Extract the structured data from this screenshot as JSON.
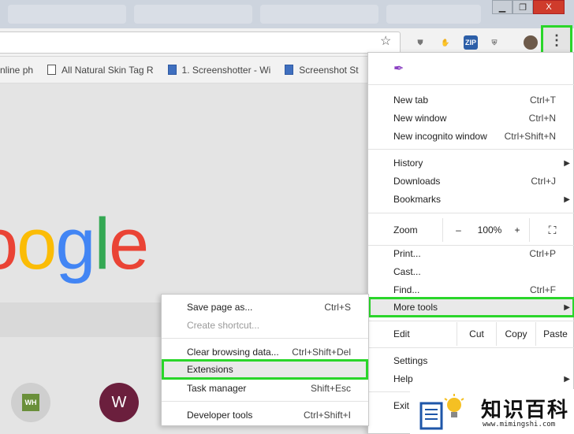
{
  "window": {
    "minimize": "▁",
    "restore": "❐",
    "close": "X"
  },
  "bookmarks": [
    {
      "label": "nline ph",
      "icon": "page-icon"
    },
    {
      "label": "All Natural Skin Tag R",
      "icon": "page-icon"
    },
    {
      "label": "1. Screenshotter - Wi",
      "icon": "doc-icon"
    },
    {
      "label": "Screenshot St",
      "icon": "doc-icon"
    }
  ],
  "extensions": {
    "zip_label": "ZIP"
  },
  "page": {
    "logo": [
      "o",
      "o",
      "g",
      "l",
      "e"
    ],
    "tile_label": "W",
    "tile_wh": "WH"
  },
  "colors": {
    "blue": "#4285f4",
    "red": "#ea4335",
    "yellow": "#fbbc05",
    "green": "#34a853",
    "highlight": "#2ad62a"
  },
  "menu": {
    "new_tab": {
      "label": "New tab",
      "shortcut": "Ctrl+T"
    },
    "new_window": {
      "label": "New window",
      "shortcut": "Ctrl+N"
    },
    "new_incognito": {
      "label": "New incognito window",
      "shortcut": "Ctrl+Shift+N"
    },
    "history": {
      "label": "History"
    },
    "downloads": {
      "label": "Downloads",
      "shortcut": "Ctrl+J"
    },
    "bookmarks": {
      "label": "Bookmarks"
    },
    "zoom": {
      "label": "Zoom",
      "minus": "–",
      "value": "100%",
      "plus": "+"
    },
    "print": {
      "label": "Print...",
      "shortcut": "Ctrl+P"
    },
    "cast": {
      "label": "Cast..."
    },
    "find": {
      "label": "Find...",
      "shortcut": "Ctrl+F"
    },
    "more_tools": {
      "label": "More tools"
    },
    "edit": {
      "label": "Edit",
      "cut": "Cut",
      "copy": "Copy",
      "paste": "Paste"
    },
    "settings": {
      "label": "Settings"
    },
    "help": {
      "label": "Help"
    },
    "exit": {
      "label": "Exit"
    }
  },
  "submenu": {
    "save_page": {
      "label": "Save page as...",
      "shortcut": "Ctrl+S"
    },
    "create_shortcut": {
      "label": "Create shortcut..."
    },
    "clear_data": {
      "label": "Clear browsing data...",
      "shortcut": "Ctrl+Shift+Del"
    },
    "extensions": {
      "label": "Extensions"
    },
    "task_manager": {
      "label": "Task manager",
      "shortcut": "Shift+Esc"
    },
    "dev_tools": {
      "label": "Developer tools",
      "shortcut": "Ctrl+Shift+I"
    }
  },
  "watermark": {
    "title": "知识百科",
    "url": "www.mimingshi.com"
  }
}
